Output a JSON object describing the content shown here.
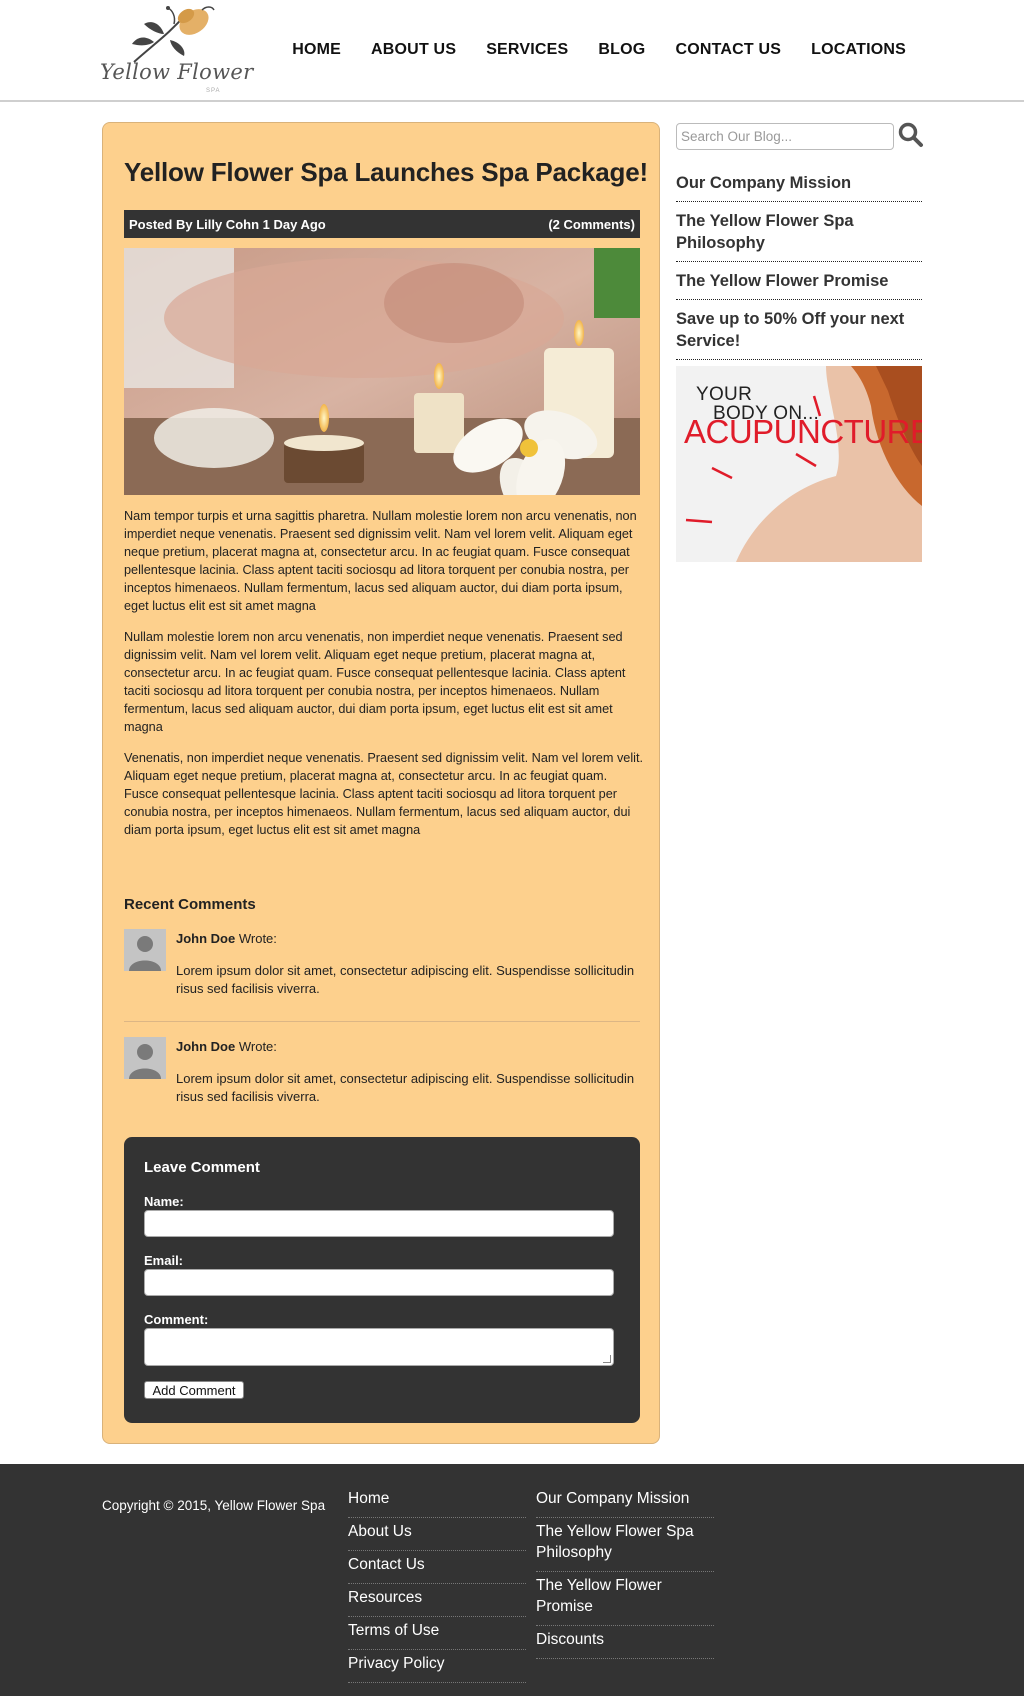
{
  "brand": {
    "logo_text": "Yellow Flower",
    "logo_sub": "SPA"
  },
  "nav": [
    {
      "label": "HOME"
    },
    {
      "label": "ABOUT US"
    },
    {
      "label": "SERVICES"
    },
    {
      "label": "BLOG"
    },
    {
      "label": "CONTACT US"
    },
    {
      "label": "LOCATIONS"
    }
  ],
  "post": {
    "title": "Yellow Flower Spa Launches Spa Package!",
    "posted_by_prefix": "Posted By ",
    "author_and_date": "Lilly Cohn 1 Day Ago",
    "comments_count": "(2 Comments)",
    "paragraphs": [
      "Nam tempor turpis et urna sagittis pharetra. Nullam molestie lorem non arcu venenatis, non imperdiet neque venenatis. Praesent sed dignissim velit. Nam vel lorem velit. Aliquam eget neque pretium, placerat magna at, consectetur arcu. In ac feugiat quam. Fusce consequat pellentesque lacinia. Class aptent taciti sociosqu ad litora torquent per conubia nostra, per inceptos himenaeos. Nullam fermentum, lacus sed aliquam auctor, dui diam porta ipsum, eget luctus elit est sit amet magna",
      "Nullam molestie lorem non arcu venenatis, non imperdiet neque venenatis. Praesent sed dignissim velit. Nam vel lorem velit. Aliquam eget neque pretium, placerat magna at, consectetur arcu. In ac feugiat quam. Fusce consequat pellentesque lacinia. Class aptent taciti sociosqu ad litora torquent per conubia nostra, per inceptos himenaeos. Nullam fermentum, lacus sed aliquam auctor, dui diam porta ipsum, eget luctus elit est sit amet magna",
      "Venenatis, non imperdiet neque venenatis. Praesent sed dignissim velit. Nam vel lorem velit. Aliquam eget neque pretium, placerat magna at, consectetur arcu. In ac feugiat quam. Fusce consequat pellentesque lacinia. Class aptent taciti sociosqu ad litora torquent per conubia nostra, per inceptos himenaeos. Nullam fermentum, lacus sed aliquam auctor, dui diam porta ipsum, eget luctus elit est sit amet magna"
    ]
  },
  "recent_comments": {
    "title": "Recent Comments",
    "items": [
      {
        "name": "John Doe",
        "wrote": " Wrote:",
        "text": "Lorem ipsum dolor sit amet, consectetur adipiscing elit. Suspendisse sollicitudin risus sed facilisis viverra."
      },
      {
        "name": "John Doe",
        "wrote": " Wrote:",
        "text": "Lorem ipsum dolor sit amet, consectetur adipiscing elit. Suspendisse sollicitudin risus sed facilisis viverra."
      }
    ]
  },
  "leave_comment": {
    "title": "Leave Comment",
    "name_label": "Name:",
    "email_label": "Email:",
    "comment_label": "Comment:",
    "name_value": "",
    "email_value": "",
    "comment_value": "",
    "submit_label": "Add Comment"
  },
  "sidebar": {
    "search_placeholder": "Search Our Blog...",
    "links": [
      {
        "label": "Our Company Mission"
      },
      {
        "label": "The Yellow Flower Spa Philosophy"
      },
      {
        "label": "The Yellow Flower Promise"
      },
      {
        "label": "Save up to 50% Off your next Service!"
      }
    ],
    "ad": {
      "line1": "YOUR",
      "line2": "BODY ON...",
      "line3": "ACUPUNCTURE"
    }
  },
  "footer": {
    "copyright": "Copyright © 2015, Yellow Flower Spa",
    "col1": [
      {
        "label": "Home"
      },
      {
        "label": "About Us"
      },
      {
        "label": "Contact Us"
      },
      {
        "label": "Resources"
      },
      {
        "label": "Terms of Use"
      },
      {
        "label": "Privacy Policy"
      }
    ],
    "col2": [
      {
        "label": "Our Company Mission"
      },
      {
        "label": "The Yellow Flower Spa Philosophy"
      },
      {
        "label": "The Yellow Flower Promise"
      },
      {
        "label": "Discounts"
      }
    ]
  },
  "colors": {
    "post_bg": "#fdd08d",
    "dark": "#333333",
    "ad_red": "#e01c2a"
  }
}
